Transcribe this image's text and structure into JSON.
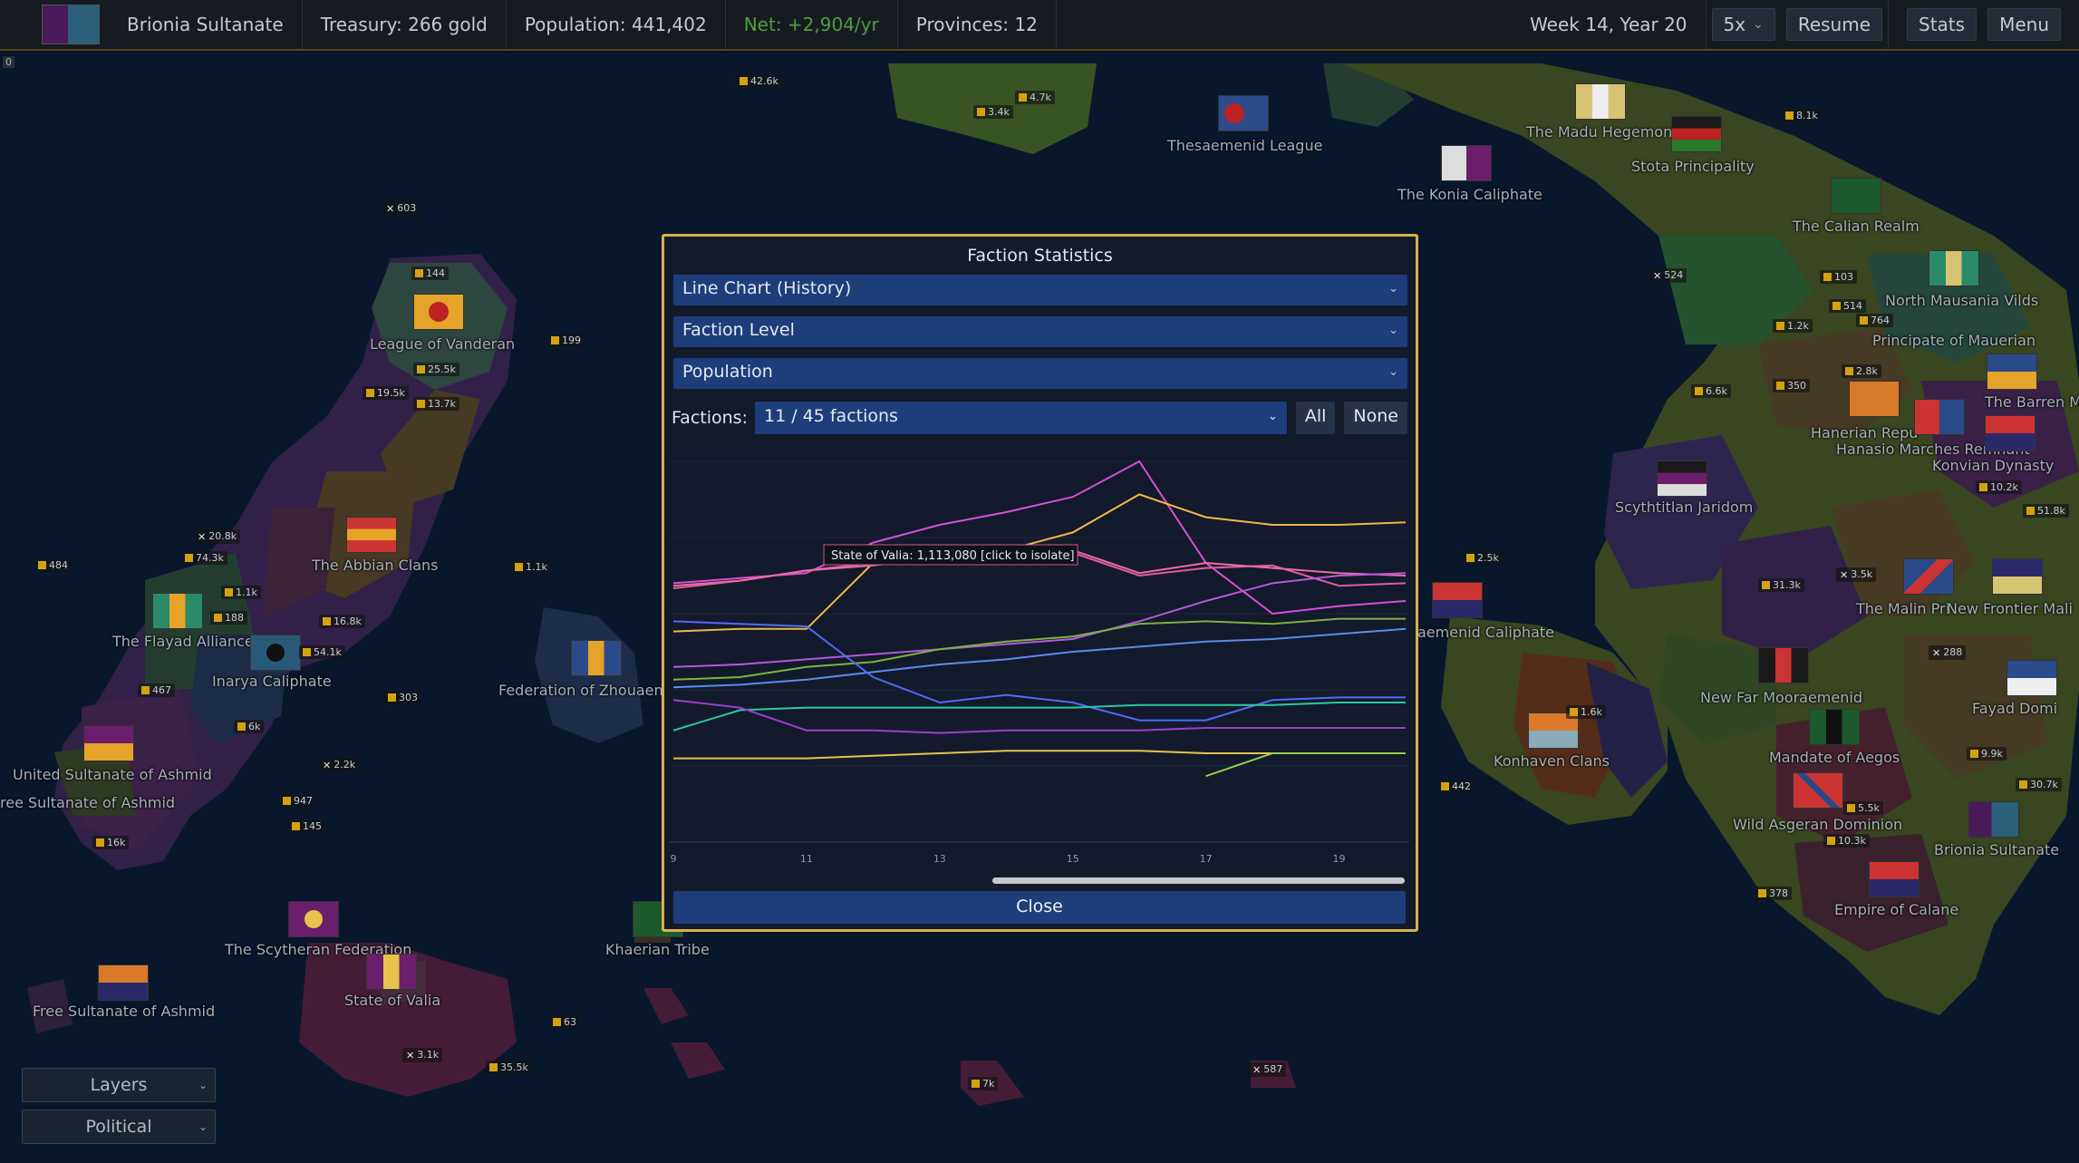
{
  "top_bar": {
    "faction_name": "Brionia Sultanate",
    "treasury": "Treasury: 266 gold",
    "population": "Population: 441,402",
    "net": "Net: +2,904/yr",
    "provinces": "Provinces: 12",
    "date": "Week 14, Year 20",
    "speed": "5x",
    "resume": "Resume",
    "stats": "Stats",
    "menu": "Menu"
  },
  "corner_indicator": "0",
  "dialog": {
    "title": "Faction Statistics",
    "chart_type_select": "Line Chart (History)",
    "level_select": "Faction Level",
    "metric_select": "Population",
    "factions_label": "Factions:",
    "factions_select": "11 / 45 factions",
    "all_button": "All",
    "none_button": "None",
    "close_button": "Close",
    "tooltip": "State of Valia: 1,113,080 [click to isolate]"
  },
  "chart_data": {
    "type": "line",
    "metric": "Population",
    "x": [
      9,
      10,
      11,
      12,
      13,
      14,
      15,
      16,
      17,
      18,
      19,
      20
    ],
    "x_ticks": [
      "9",
      "11",
      "13",
      "15",
      "17",
      "19"
    ],
    "ylim": [
      0,
      1500
    ],
    "y_axis_labels_shown": false,
    "grid": true,
    "series": [
      {
        "color": "#d84fd8",
        "values": [
          1020,
          1040,
          1060,
          1180,
          1250,
          1300,
          1360,
          1500,
          1100,
          900,
          930,
          950
        ]
      },
      {
        "color": "#f0b84a",
        "values": [
          830,
          840,
          840,
          1100,
          1140,
          1150,
          1220,
          1370,
          1280,
          1250,
          1250,
          1260
        ]
      },
      {
        "color": "#e15c9c",
        "values": [
          1000,
          1030,
          1070,
          1100,
          1113,
          1130,
          1140,
          1050,
          1080,
          1090,
          1010,
          1020
        ]
      },
      {
        "color": "#ea6da0",
        "values": [
          1010,
          1030,
          1070,
          1090,
          1120,
          1140,
          1150,
          1060,
          1100,
          1080,
          1060,
          1050
        ]
      },
      {
        "color": "#b25ad8",
        "values": [
          690,
          700,
          720,
          740,
          760,
          780,
          800,
          870,
          950,
          1020,
          1050,
          1060
        ]
      },
      {
        "color": "#7cb342",
        "values": [
          640,
          650,
          690,
          710,
          760,
          790,
          810,
          860,
          870,
          860,
          880,
          880
        ]
      },
      {
        "color": "#5a8cf0",
        "values": [
          610,
          620,
          640,
          670,
          700,
          720,
          750,
          770,
          790,
          800,
          820,
          840
        ]
      },
      {
        "color": "#4f6bff",
        "values": [
          870,
          860,
          850,
          650,
          550,
          580,
          550,
          480,
          480,
          560,
          570,
          570
        ]
      },
      {
        "color": "#2cc9a0",
        "values": [
          440,
          520,
          530,
          530,
          530,
          530,
          530,
          540,
          540,
          540,
          550,
          550
        ]
      },
      {
        "color": "#9b3fcf",
        "values": [
          560,
          530,
          440,
          440,
          430,
          440,
          440,
          440,
          450,
          450,
          450,
          450
        ]
      },
      {
        "color": "#e6c34a",
        "values": [
          330,
          330,
          330,
          340,
          350,
          360,
          360,
          360,
          350,
          350,
          350,
          350
        ]
      },
      {
        "color": "#8fd14f",
        "values": [
          null,
          null,
          null,
          null,
          null,
          null,
          null,
          null,
          260,
          350,
          350,
          350
        ]
      }
    ]
  },
  "bottom_left": {
    "layers": "Layers",
    "political": "Political"
  },
  "map": {
    "labels": [
      {
        "text": "Thesaemenid League"
      },
      {
        "text": "The Konia Caliphate"
      },
      {
        "text": "The Madu Hegemon"
      },
      {
        "text": "Stota Principality"
      },
      {
        "text": "The Calian Realm"
      },
      {
        "text": "North Mausania Vilds"
      },
      {
        "text": "Principate of Mauerian"
      },
      {
        "text": "The Barren Ma"
      },
      {
        "text": "Hanerian Repu"
      },
      {
        "text": "Hanasio Marches Remnant"
      },
      {
        "text": "Konvian Dynasty"
      },
      {
        "text": "Scythtitlan Jaridom"
      },
      {
        "text": "The Malin Pri"
      },
      {
        "text": "New Frontier Mali"
      },
      {
        "text": "aemenid Caliphate"
      },
      {
        "text": "New Far Mooraemenid"
      },
      {
        "text": "Fayad Domi"
      },
      {
        "text": "Mandate of Aegos"
      },
      {
        "text": "Konhaven Clans"
      },
      {
        "text": "Wild Asgeran Dominion"
      },
      {
        "text": "Brionia Sultanate"
      },
      {
        "text": "Empire of Calane"
      },
      {
        "text": "League of Vanderan"
      },
      {
        "text": "The Abbian Clans"
      },
      {
        "text": "The Flayad Alliance"
      },
      {
        "text": "Inarya Caliphate"
      },
      {
        "text": "Federation of Zhouaen"
      },
      {
        "text": "United Sultanate of Ashmid"
      },
      {
        "text": "ree Sultanate of Ashmid"
      },
      {
        "text": "The Scytheran Federation"
      },
      {
        "text": "State of Valia"
      },
      {
        "text": "Khaerian Tribe"
      },
      {
        "text": "Free Sultanate of Ashmid"
      }
    ],
    "badges": [
      {
        "text": "42.6k"
      },
      {
        "text": "4.7k"
      },
      {
        "text": "3.4k"
      },
      {
        "text": "603"
      },
      {
        "text": "144"
      },
      {
        "text": "199"
      },
      {
        "text": "25.5k"
      },
      {
        "text": "19.5k"
      },
      {
        "text": "13.7k"
      },
      {
        "text": "20.8k"
      },
      {
        "text": "74.3k"
      },
      {
        "text": "484"
      },
      {
        "text": "1.1k"
      },
      {
        "text": "1.1k"
      },
      {
        "text": "188"
      },
      {
        "text": "16.8k"
      },
      {
        "text": "54.1k"
      },
      {
        "text": "467"
      },
      {
        "text": "6k"
      },
      {
        "text": "303"
      },
      {
        "text": "2.2k"
      },
      {
        "text": "947"
      },
      {
        "text": "145"
      },
      {
        "text": "16k"
      },
      {
        "text": "63"
      },
      {
        "text": "3.1k"
      },
      {
        "text": "35.5k"
      },
      {
        "text": "7k"
      },
      {
        "text": "587"
      },
      {
        "text": "8.1k"
      },
      {
        "text": "524"
      },
      {
        "text": "103"
      },
      {
        "text": "514"
      },
      {
        "text": "764"
      },
      {
        "text": "1.2k"
      },
      {
        "text": "2.8k"
      },
      {
        "text": "350"
      },
      {
        "text": "6.6k"
      },
      {
        "text": "10.2k"
      },
      {
        "text": "51.8k"
      },
      {
        "text": "2.5k"
      },
      {
        "text": "31.3k"
      },
      {
        "text": "3.5k"
      },
      {
        "text": "288"
      },
      {
        "text": "1.6k"
      },
      {
        "text": "442"
      },
      {
        "text": "9.9k"
      },
      {
        "text": "30.7k"
      },
      {
        "text": "5.5k"
      },
      {
        "text": "10.3k"
      },
      {
        "text": "378"
      }
    ]
  }
}
